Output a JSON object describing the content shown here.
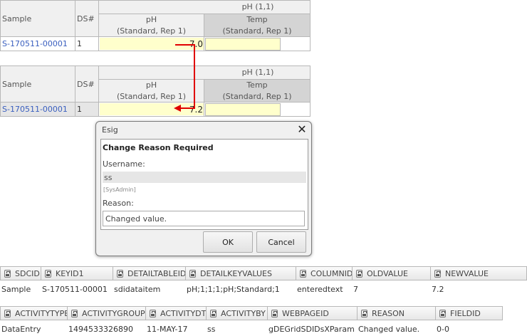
{
  "grid_before": {
    "col_sample": "Sample",
    "col_ds": "DS#",
    "group_header": "pH (1,1)",
    "col_ph": "pH",
    "col_ph_sub": "(Standard, Rep 1)",
    "col_temp": "Temp",
    "col_temp_sub": "(Standard, Rep 1)",
    "row": {
      "sample": "S-170511-00001",
      "ds": "1",
      "ph": "7.0",
      "temp": ""
    }
  },
  "grid_after": {
    "col_sample": "Sample",
    "col_ds": "DS#",
    "group_header": "pH (1,1)",
    "col_ph": "pH",
    "col_ph_sub": "(Standard, Rep 1)",
    "col_temp": "Temp",
    "col_temp_sub": "(Standard, Rep 1)",
    "row": {
      "sample": "S-170511-00001",
      "ds": "1",
      "ph": "7.2",
      "temp": ""
    }
  },
  "dialog": {
    "title": "Esig",
    "heading": "Change Reason Required",
    "username_label": "Username:",
    "username_value": "ss",
    "role": "[SysAdmin]",
    "reason_label": "Reason:",
    "reason_value": "Changed value.",
    "ok_label": "OK",
    "cancel_label": "Cancel"
  },
  "audit1": {
    "headers": [
      "SDCID",
      "KEYID1",
      "DETAILTABLEID",
      "DETAILKEYVALUES",
      "COLUMNID",
      "OLDVALUE",
      "NEWVALUE"
    ],
    "row": [
      "Sample",
      "S-170511-00001",
      "sdidataitem",
      "pH;1;1;1;pH;Standard;1",
      "enteredtext",
      "7",
      "7.2"
    ]
  },
  "audit2": {
    "headers": [
      "ACTIVITYTYPE",
      "ACTIVITYGROUP",
      "ACTIVITYDT",
      "ACTIVITYBY",
      "WEBPAGEID",
      "REASON",
      "FIELDID"
    ],
    "row": [
      "DataEntry",
      "1494533326890",
      "11-MAY-17",
      "ss",
      "gDEGridSDIDsXParam",
      "Changed value.",
      "0-0"
    ]
  },
  "colors": {
    "link": "#3a5fbf",
    "value_bg": "#ffffcc",
    "arrow": "#e00000",
    "header_grey": "#d4d4d4"
  }
}
